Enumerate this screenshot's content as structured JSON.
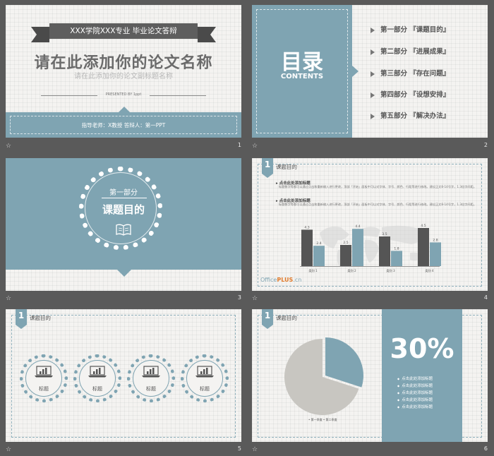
{
  "slide1": {
    "ribbon": "XXX学院XXX专业 毕业论文答辩",
    "title": "请在此添加你的论文名称",
    "subtitle": "请在此添加你的论文副标题名称",
    "presented": "PRESENTED BY 1ppt",
    "footer": "指导老师：X教授  答辩人：第一PPT",
    "number": "1"
  },
  "slide2": {
    "big": "目录",
    "en": "CONTENTS",
    "items": [
      "第一部分 『课题目的』",
      "第二部分 『进展成果』",
      "第三部分 『存在问题』",
      "第四部分 『设想安排』",
      "第五部分 『解决办法』"
    ],
    "number": "2"
  },
  "slide3": {
    "part": "第一部分",
    "title": "课题目的",
    "number": "3"
  },
  "slide4": {
    "tab": "1",
    "title": "课题目的",
    "h1": "点击此处添加标题",
    "p1": "标题数字等都可以通过点击和重新输入进行更改，顶部「开始」面板中可以对字体、字号、颜色、行距等进行修改。建议正文8-14号字，1.3倍字间距。",
    "h2": "点击此处添加标题",
    "p2": "标题数字等都可以通过点击和重新输入进行更改，顶部「开始」面板中可以对字体、字号、颜色、行距等进行修改。建议正文8-14号字，1.3倍字间距。",
    "logo_a": "Office",
    "logo_b": "PLUS",
    "logo_c": ".cn",
    "number": "4"
  },
  "chart_data": {
    "type": "bar",
    "categories": [
      "类别 1",
      "类别 2",
      "类别 3",
      "类别 4"
    ],
    "series": [
      {
        "values": [
          4.3,
          2.5,
          3.5,
          4.5
        ],
        "color": "#555555"
      },
      {
        "values": [
          2.4,
          4.4,
          1.8,
          2.8
        ],
        "color": "#7fa4b2"
      }
    ],
    "ylim": [
      0,
      5
    ]
  },
  "slide5": {
    "tab": "1",
    "title": "课题目的",
    "labels": [
      "标题",
      "标题",
      "标题",
      "标题"
    ],
    "number": "5"
  },
  "slide6": {
    "tab": "1",
    "title": "课题目的",
    "percent": "30%",
    "items": [
      "点击此处添加标题",
      "点击此处添加标题",
      "点击此处添加标题",
      "点击此处添加标题",
      "点击此处添加标题"
    ],
    "legend": "• 第一季度  • 第二季度",
    "pie": [
      70,
      30
    ],
    "pie_colors": [
      "#c8c6c1",
      "#7fa4b2"
    ],
    "number": "6"
  },
  "icons": {
    "star": "☆"
  }
}
